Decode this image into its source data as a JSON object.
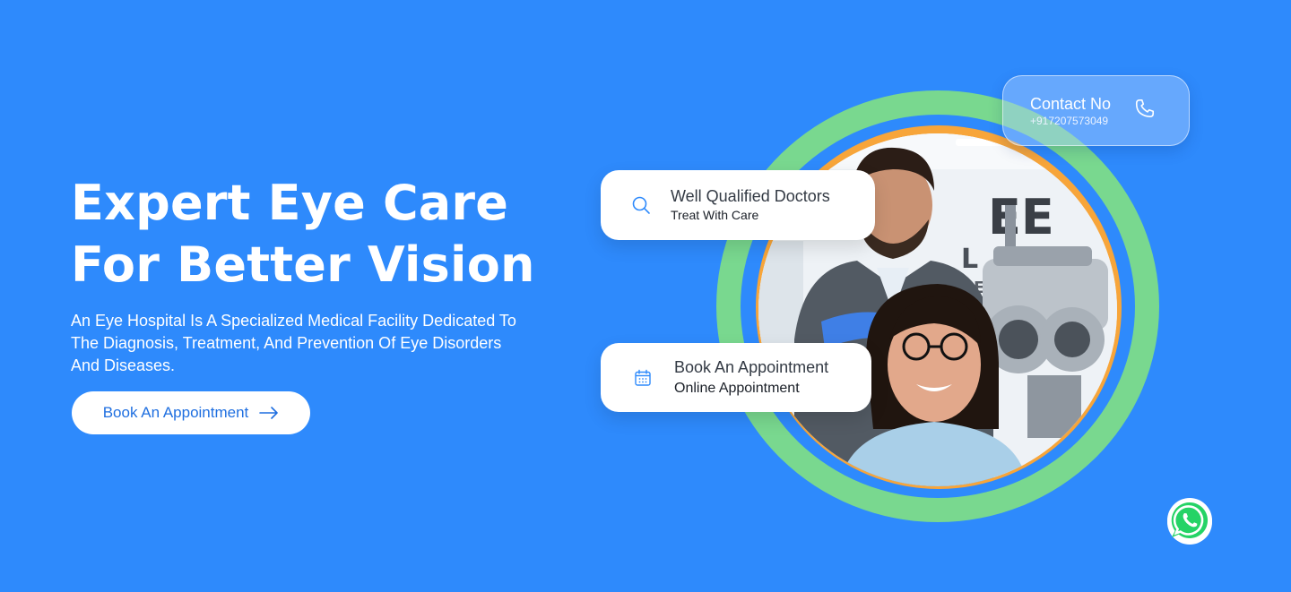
{
  "hero": {
    "title_line1": "Expert Eye Care",
    "title_line2": "For Better Vision",
    "description": "An Eye Hospital Is A Specialized Medical Facility Dedicated To The Diagnosis, Treatment, And Prevention Of Eye Disorders And Diseases.",
    "cta_label": "Book An Appointment",
    "cta_icon": "arrow-right-icon"
  },
  "cards": {
    "doctors": {
      "title": "Well Qualified Doctors",
      "subtitle": "Treat With Care",
      "icon": "search-icon"
    },
    "appointment": {
      "title": "Book An Appointment",
      "subtitle": "Online Appointment",
      "icon": "calendar-icon"
    }
  },
  "contact": {
    "title": "Contact No",
    "number": "+917207573049",
    "icon": "phone-icon"
  },
  "whatsapp": {
    "icon": "whatsapp-icon"
  },
  "eye_chart": {
    "row1": "EE",
    "row2": "LP",
    "row3": "EX"
  },
  "colors": {
    "background": "#2e8afc",
    "ring_green": "#79d88f",
    "ring_orange": "#f7a53a",
    "accent_blue": "#1f6fe0",
    "whatsapp_green": "#25d366"
  }
}
